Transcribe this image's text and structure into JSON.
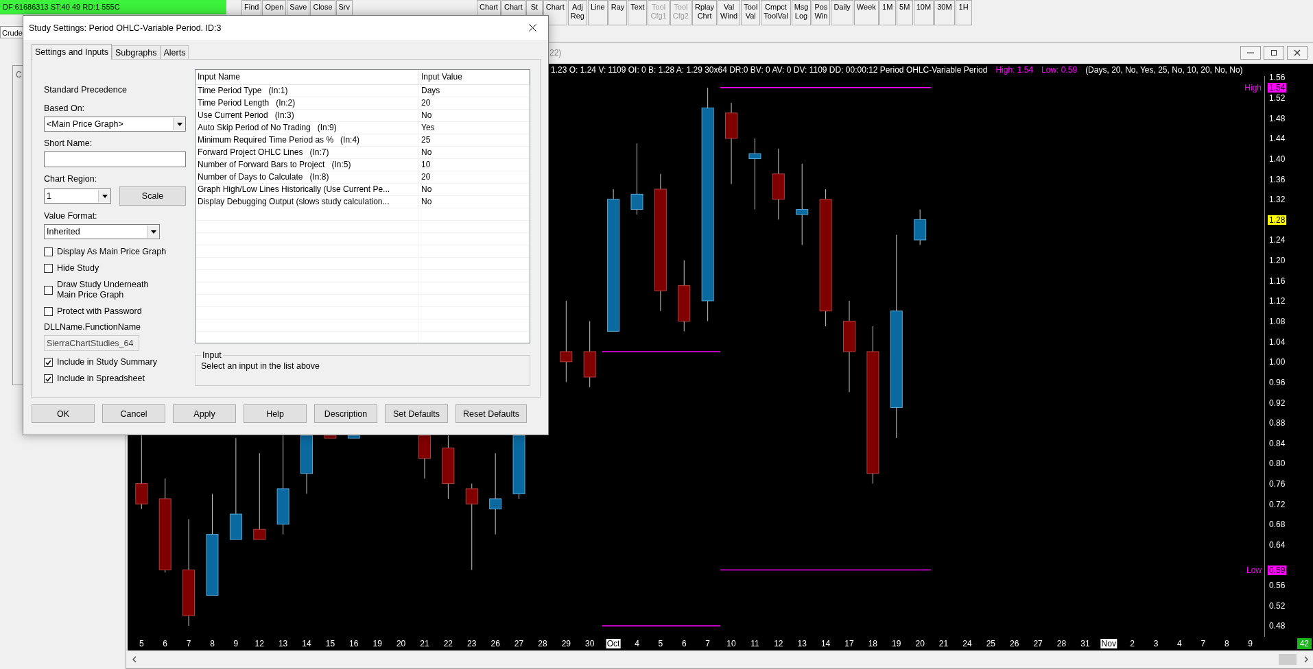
{
  "status_strip": {
    "text": "DF:61686313 ST:40 49 RD:1 555C"
  },
  "chartbook_tab": "Crude",
  "toolbar_left": [
    {
      "lines": [
        "Find"
      ],
      "disabled": false
    },
    {
      "lines": [
        "Open"
      ],
      "disabled": false
    },
    {
      "lines": [
        "Save"
      ],
      "disabled": false
    },
    {
      "lines": [
        "Close"
      ],
      "disabled": false
    },
    {
      "lines": [
        "Srv"
      ],
      "disabled": false
    }
  ],
  "toolbar_right": [
    {
      "lines": [
        "Chart"
      ],
      "disabled": false
    },
    {
      "lines": [
        "Chart"
      ],
      "disabled": false
    },
    {
      "lines": [
        "St"
      ],
      "disabled": false
    },
    {
      "lines": [
        "Chart"
      ],
      "disabled": false
    },
    {
      "lines": [
        "Adj",
        "Reg"
      ],
      "disabled": false
    },
    {
      "lines": [
        "Line"
      ],
      "disabled": false
    },
    {
      "lines": [
        "Ray"
      ],
      "disabled": false
    },
    {
      "lines": [
        "Text"
      ],
      "disabled": false
    },
    {
      "lines": [
        "Tool",
        "Cfg1"
      ],
      "disabled": true
    },
    {
      "lines": [
        "Tool",
        "Cfg2"
      ],
      "disabled": true
    },
    {
      "lines": [
        "Rplay",
        "Chrt"
      ],
      "disabled": false
    },
    {
      "lines": [
        "Val",
        "Wind"
      ],
      "disabled": false
    },
    {
      "lines": [
        "Tool",
        "Val"
      ],
      "disabled": false
    },
    {
      "lines": [
        "Cmpct",
        "ToolVal"
      ],
      "disabled": false
    },
    {
      "lines": [
        "Msg",
        "Log"
      ],
      "disabled": false
    },
    {
      "lines": [
        "Pos",
        "Win"
      ],
      "disabled": false
    },
    {
      "lines": [
        "Daily"
      ],
      "disabled": false
    },
    {
      "lines": [
        "Week"
      ],
      "disabled": false
    },
    {
      "lines": [
        "1M"
      ],
      "disabled": false
    },
    {
      "lines": [
        "5M"
      ],
      "disabled": false
    },
    {
      "lines": [
        "10M"
      ],
      "disabled": false
    },
    {
      "lines": [
        "30M"
      ],
      "disabled": false
    },
    {
      "lines": [
        "1H"
      ],
      "disabled": false
    }
  ],
  "background_window": {
    "title": "C"
  },
  "chart_window": {
    "title": "22)",
    "info": {
      "quote": "1.23 O: 1.24 V: 1109 OI: 0 B: 1.28 A: 1.29 30x64 DR:0 BV: 0 AV: 0 DV: 1109 DD: 00:00:12 Period OHLC-Variable Period",
      "high": "High: 1.54",
      "low": "Low: 0.59",
      "inputs": "(Days, 20, No, Yes, 25, No, 10, 20, No, No)"
    },
    "price_axis": {
      "labels": [
        "1.56",
        "1.52",
        "1.48",
        "1.44",
        "1.40",
        "1.36",
        "1.32",
        "1.24",
        "1.20",
        "1.16",
        "1.12",
        "1.08",
        "1.04",
        "1.00",
        "0.96",
        "0.92",
        "0.88",
        "0.84",
        "0.80",
        "0.76",
        "0.72",
        "0.68",
        "0.64",
        "0.56",
        "0.52",
        "0.48"
      ],
      "markers": [
        {
          "kind": "high",
          "caption": "High",
          "value": "1.54"
        },
        {
          "kind": "current",
          "value": "1.28"
        },
        {
          "kind": "low",
          "caption": "Low",
          "value": "0.59"
        }
      ]
    },
    "date_axis": [
      {
        "text": "5",
        "kind": "day"
      },
      {
        "text": "6",
        "kind": "day"
      },
      {
        "text": "7",
        "kind": "day"
      },
      {
        "text": "8",
        "kind": "day"
      },
      {
        "text": "9",
        "kind": "day"
      },
      {
        "text": "12",
        "kind": "day"
      },
      {
        "text": "13",
        "kind": "day"
      },
      {
        "text": "14",
        "kind": "day"
      },
      {
        "text": "15",
        "kind": "day"
      },
      {
        "text": "16",
        "kind": "day"
      },
      {
        "text": "19",
        "kind": "day"
      },
      {
        "text": "20",
        "kind": "day"
      },
      {
        "text": "21",
        "kind": "day"
      },
      {
        "text": "22",
        "kind": "day"
      },
      {
        "text": "23",
        "kind": "day"
      },
      {
        "text": "26",
        "kind": "day"
      },
      {
        "text": "27",
        "kind": "day"
      },
      {
        "text": "28",
        "kind": "day"
      },
      {
        "text": "29",
        "kind": "day"
      },
      {
        "text": "30",
        "kind": "day"
      },
      {
        "text": "Oct",
        "kind": "month"
      },
      {
        "text": "4",
        "kind": "day"
      },
      {
        "text": "5",
        "kind": "day"
      },
      {
        "text": "6",
        "kind": "day"
      },
      {
        "text": "7",
        "kind": "day"
      },
      {
        "text": "10",
        "kind": "day"
      },
      {
        "text": "11",
        "kind": "day"
      },
      {
        "text": "12",
        "kind": "day"
      },
      {
        "text": "13",
        "kind": "day"
      },
      {
        "text": "14",
        "kind": "day"
      },
      {
        "text": "17",
        "kind": "day"
      },
      {
        "text": "18",
        "kind": "day"
      },
      {
        "text": "19",
        "kind": "day"
      },
      {
        "text": "20",
        "kind": "day"
      },
      {
        "text": "21",
        "kind": "day"
      },
      {
        "text": "24",
        "kind": "day"
      },
      {
        "text": "25",
        "kind": "day"
      },
      {
        "text": "26",
        "kind": "day"
      },
      {
        "text": "27",
        "kind": "day"
      },
      {
        "text": "28",
        "kind": "day"
      },
      {
        "text": "31",
        "kind": "day"
      },
      {
        "text": "Nov",
        "kind": "month"
      },
      {
        "text": "2",
        "kind": "day"
      },
      {
        "text": "3",
        "kind": "day"
      },
      {
        "text": "4",
        "kind": "day"
      },
      {
        "text": "7",
        "kind": "day"
      },
      {
        "text": "8",
        "kind": "day"
      },
      {
        "text": "9",
        "kind": "day"
      }
    ],
    "bar_count": "42"
  },
  "dialog": {
    "title": "Study Settings: Period OHLC-Variable Period. ID:3",
    "tabs": [
      {
        "label": "Settings and Inputs",
        "selected": true
      },
      {
        "label": "Subgraphs",
        "selected": false
      },
      {
        "label": "Alerts",
        "selected": false
      }
    ],
    "precedence": "Standard Precedence",
    "based_on": {
      "label": "Based On:",
      "value": "<Main Price Graph>"
    },
    "short_name": {
      "label": "Short Name:"
    },
    "chart_region": {
      "label": "Chart Region:",
      "value": "1"
    },
    "scale_button": "Scale",
    "value_format": {
      "label": "Value Format:",
      "value": "Inherited"
    },
    "options": [
      {
        "label": "Display As Main Price Graph",
        "checked": false
      },
      {
        "label": "Hide Study",
        "checked": false
      },
      {
        "label": "Draw Study Underneath\nMain Price Graph",
        "checked": false
      },
      {
        "label": "Protect with Password",
        "checked": false
      }
    ],
    "dll": {
      "label": "DLLName.FunctionName",
      "value": "SierraChartStudies_64"
    },
    "summary_options": [
      {
        "label": "Include in Study Summary",
        "checked": true
      },
      {
        "label": "Include in Spreadsheet",
        "checked": true
      }
    ],
    "inputs_table": {
      "columns": [
        "Input Name",
        "Input Value"
      ],
      "rows": [
        {
          "name": "Time Period Type   (In:1)",
          "value": "Days"
        },
        {
          "name": "Time Period Length   (In:2)",
          "value": "20"
        },
        {
          "name": "Use Current Period   (In:3)",
          "value": "No"
        },
        {
          "name": "Auto Skip Period of No Trading   (In:9)",
          "value": "Yes"
        },
        {
          "name": "Minimum Required Time Period as %   (In:4)",
          "value": "25"
        },
        {
          "name": "Forward Project OHLC Lines   (In:7)",
          "value": "No"
        },
        {
          "name": "Number of Forward Bars to Project   (In:5)",
          "value": "10"
        },
        {
          "name": "Number of Days to Calculate   (In:8)",
          "value": "20"
        },
        {
          "name": "Graph High/Low Lines Historically (Use Current Pe...",
          "value": "No"
        },
        {
          "name": "Display Debugging Output (slows study calculation...",
          "value": "No"
        }
      ]
    },
    "input_group": {
      "title": "Input",
      "hint": "Select an input in the list above"
    },
    "buttons": [
      "OK",
      "Cancel",
      "Apply",
      "Help",
      "Description",
      "Set Defaults",
      "Reset Defaults"
    ]
  }
}
